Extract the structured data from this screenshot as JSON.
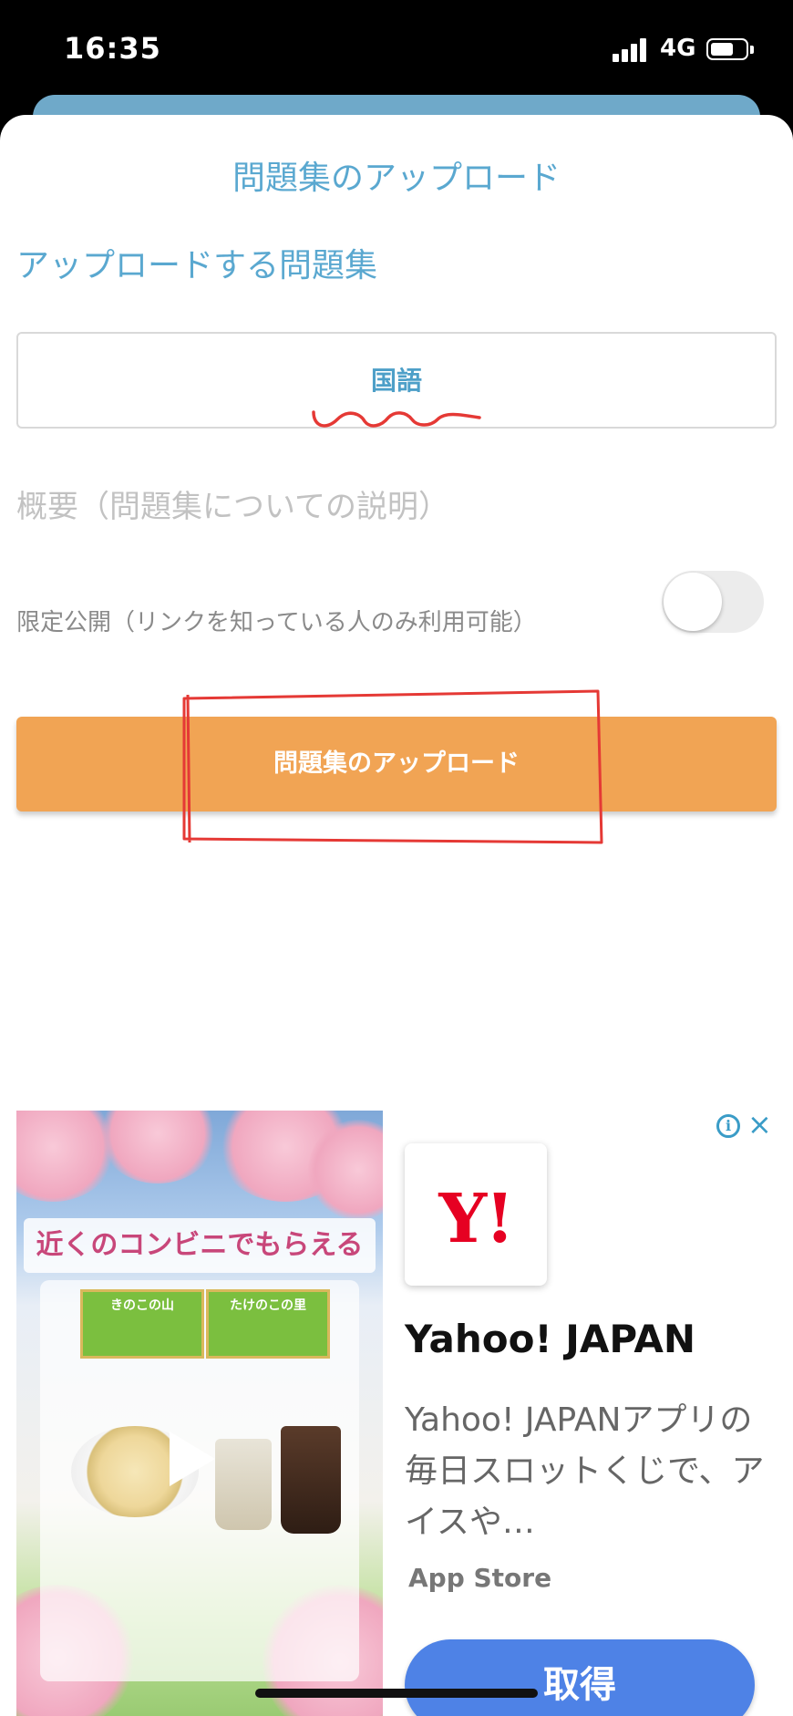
{
  "status_bar": {
    "time": "16:35",
    "network": "4G"
  },
  "upload_sheet": {
    "title": "問題集のアップロード",
    "section_label": "アップロードする問題集",
    "problem_set_name": "国語",
    "description_placeholder": "概要（問題集についての説明）",
    "limited_public_label": "限定公開（リンクを知っている人のみ利用可能）",
    "limited_public_enabled": false,
    "upload_button_label": "問題集のアップロード"
  },
  "ad": {
    "banner_text": "近くのコンビニでもらえる",
    "product_1": "きのこの山",
    "product_2": "たけのこの里",
    "app_icon_text": "Y!",
    "app_name": "Yahoo! JAPAN",
    "app_description": "Yahoo! JAPANアプリの毎日スロットくじで、アイスや…",
    "store": "App Store",
    "get_button_label": "取得",
    "info_icon": "i",
    "close_icon": "×"
  },
  "colors": {
    "accent_blue": "#5aa8d0",
    "upload_orange": "#f1a454",
    "get_blue": "#4e82e6",
    "yahoo_red": "#e60022",
    "annotation_red": "#e53935"
  }
}
